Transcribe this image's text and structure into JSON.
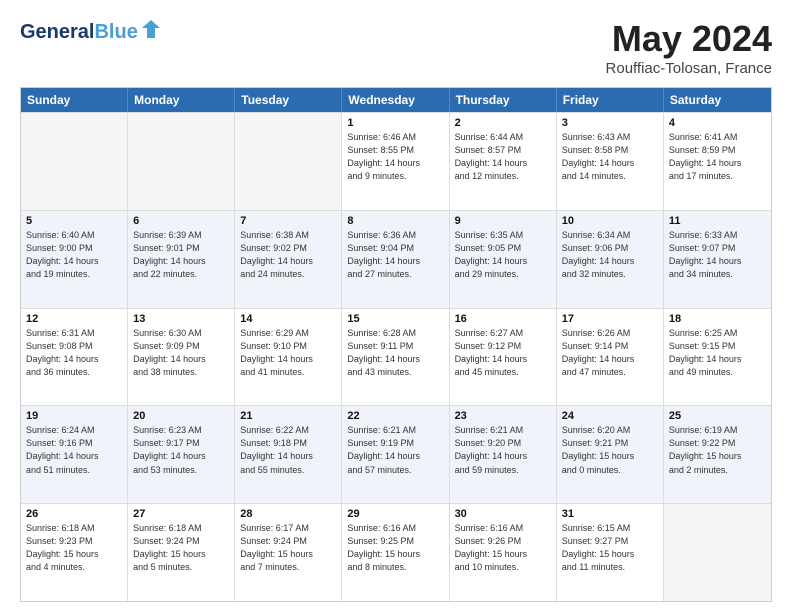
{
  "header": {
    "logo_general": "General",
    "logo_blue": "Blue",
    "title": "May 2024",
    "subtitle": "Rouffiac-Tolosan, France"
  },
  "days_of_week": [
    "Sunday",
    "Monday",
    "Tuesday",
    "Wednesday",
    "Thursday",
    "Friday",
    "Saturday"
  ],
  "rows": [
    {
      "alt": false,
      "cells": [
        {
          "day": "",
          "lines": []
        },
        {
          "day": "",
          "lines": []
        },
        {
          "day": "",
          "lines": []
        },
        {
          "day": "1",
          "lines": [
            "Sunrise: 6:46 AM",
            "Sunset: 8:55 PM",
            "Daylight: 14 hours",
            "and 9 minutes."
          ]
        },
        {
          "day": "2",
          "lines": [
            "Sunrise: 6:44 AM",
            "Sunset: 8:57 PM",
            "Daylight: 14 hours",
            "and 12 minutes."
          ]
        },
        {
          "day": "3",
          "lines": [
            "Sunrise: 6:43 AM",
            "Sunset: 8:58 PM",
            "Daylight: 14 hours",
            "and 14 minutes."
          ]
        },
        {
          "day": "4",
          "lines": [
            "Sunrise: 6:41 AM",
            "Sunset: 8:59 PM",
            "Daylight: 14 hours",
            "and 17 minutes."
          ]
        }
      ]
    },
    {
      "alt": true,
      "cells": [
        {
          "day": "5",
          "lines": [
            "Sunrise: 6:40 AM",
            "Sunset: 9:00 PM",
            "Daylight: 14 hours",
            "and 19 minutes."
          ]
        },
        {
          "day": "6",
          "lines": [
            "Sunrise: 6:39 AM",
            "Sunset: 9:01 PM",
            "Daylight: 14 hours",
            "and 22 minutes."
          ]
        },
        {
          "day": "7",
          "lines": [
            "Sunrise: 6:38 AM",
            "Sunset: 9:02 PM",
            "Daylight: 14 hours",
            "and 24 minutes."
          ]
        },
        {
          "day": "8",
          "lines": [
            "Sunrise: 6:36 AM",
            "Sunset: 9:04 PM",
            "Daylight: 14 hours",
            "and 27 minutes."
          ]
        },
        {
          "day": "9",
          "lines": [
            "Sunrise: 6:35 AM",
            "Sunset: 9:05 PM",
            "Daylight: 14 hours",
            "and 29 minutes."
          ]
        },
        {
          "day": "10",
          "lines": [
            "Sunrise: 6:34 AM",
            "Sunset: 9:06 PM",
            "Daylight: 14 hours",
            "and 32 minutes."
          ]
        },
        {
          "day": "11",
          "lines": [
            "Sunrise: 6:33 AM",
            "Sunset: 9:07 PM",
            "Daylight: 14 hours",
            "and 34 minutes."
          ]
        }
      ]
    },
    {
      "alt": false,
      "cells": [
        {
          "day": "12",
          "lines": [
            "Sunrise: 6:31 AM",
            "Sunset: 9:08 PM",
            "Daylight: 14 hours",
            "and 36 minutes."
          ]
        },
        {
          "day": "13",
          "lines": [
            "Sunrise: 6:30 AM",
            "Sunset: 9:09 PM",
            "Daylight: 14 hours",
            "and 38 minutes."
          ]
        },
        {
          "day": "14",
          "lines": [
            "Sunrise: 6:29 AM",
            "Sunset: 9:10 PM",
            "Daylight: 14 hours",
            "and 41 minutes."
          ]
        },
        {
          "day": "15",
          "lines": [
            "Sunrise: 6:28 AM",
            "Sunset: 9:11 PM",
            "Daylight: 14 hours",
            "and 43 minutes."
          ]
        },
        {
          "day": "16",
          "lines": [
            "Sunrise: 6:27 AM",
            "Sunset: 9:12 PM",
            "Daylight: 14 hours",
            "and 45 minutes."
          ]
        },
        {
          "day": "17",
          "lines": [
            "Sunrise: 6:26 AM",
            "Sunset: 9:14 PM",
            "Daylight: 14 hours",
            "and 47 minutes."
          ]
        },
        {
          "day": "18",
          "lines": [
            "Sunrise: 6:25 AM",
            "Sunset: 9:15 PM",
            "Daylight: 14 hours",
            "and 49 minutes."
          ]
        }
      ]
    },
    {
      "alt": true,
      "cells": [
        {
          "day": "19",
          "lines": [
            "Sunrise: 6:24 AM",
            "Sunset: 9:16 PM",
            "Daylight: 14 hours",
            "and 51 minutes."
          ]
        },
        {
          "day": "20",
          "lines": [
            "Sunrise: 6:23 AM",
            "Sunset: 9:17 PM",
            "Daylight: 14 hours",
            "and 53 minutes."
          ]
        },
        {
          "day": "21",
          "lines": [
            "Sunrise: 6:22 AM",
            "Sunset: 9:18 PM",
            "Daylight: 14 hours",
            "and 55 minutes."
          ]
        },
        {
          "day": "22",
          "lines": [
            "Sunrise: 6:21 AM",
            "Sunset: 9:19 PM",
            "Daylight: 14 hours",
            "and 57 minutes."
          ]
        },
        {
          "day": "23",
          "lines": [
            "Sunrise: 6:21 AM",
            "Sunset: 9:20 PM",
            "Daylight: 14 hours",
            "and 59 minutes."
          ]
        },
        {
          "day": "24",
          "lines": [
            "Sunrise: 6:20 AM",
            "Sunset: 9:21 PM",
            "Daylight: 15 hours",
            "and 0 minutes."
          ]
        },
        {
          "day": "25",
          "lines": [
            "Sunrise: 6:19 AM",
            "Sunset: 9:22 PM",
            "Daylight: 15 hours",
            "and 2 minutes."
          ]
        }
      ]
    },
    {
      "alt": false,
      "cells": [
        {
          "day": "26",
          "lines": [
            "Sunrise: 6:18 AM",
            "Sunset: 9:23 PM",
            "Daylight: 15 hours",
            "and 4 minutes."
          ]
        },
        {
          "day": "27",
          "lines": [
            "Sunrise: 6:18 AM",
            "Sunset: 9:24 PM",
            "Daylight: 15 hours",
            "and 5 minutes."
          ]
        },
        {
          "day": "28",
          "lines": [
            "Sunrise: 6:17 AM",
            "Sunset: 9:24 PM",
            "Daylight: 15 hours",
            "and 7 minutes."
          ]
        },
        {
          "day": "29",
          "lines": [
            "Sunrise: 6:16 AM",
            "Sunset: 9:25 PM",
            "Daylight: 15 hours",
            "and 8 minutes."
          ]
        },
        {
          "day": "30",
          "lines": [
            "Sunrise: 6:16 AM",
            "Sunset: 9:26 PM",
            "Daylight: 15 hours",
            "and 10 minutes."
          ]
        },
        {
          "day": "31",
          "lines": [
            "Sunrise: 6:15 AM",
            "Sunset: 9:27 PM",
            "Daylight: 15 hours",
            "and 11 minutes."
          ]
        },
        {
          "day": "",
          "lines": []
        }
      ]
    }
  ]
}
